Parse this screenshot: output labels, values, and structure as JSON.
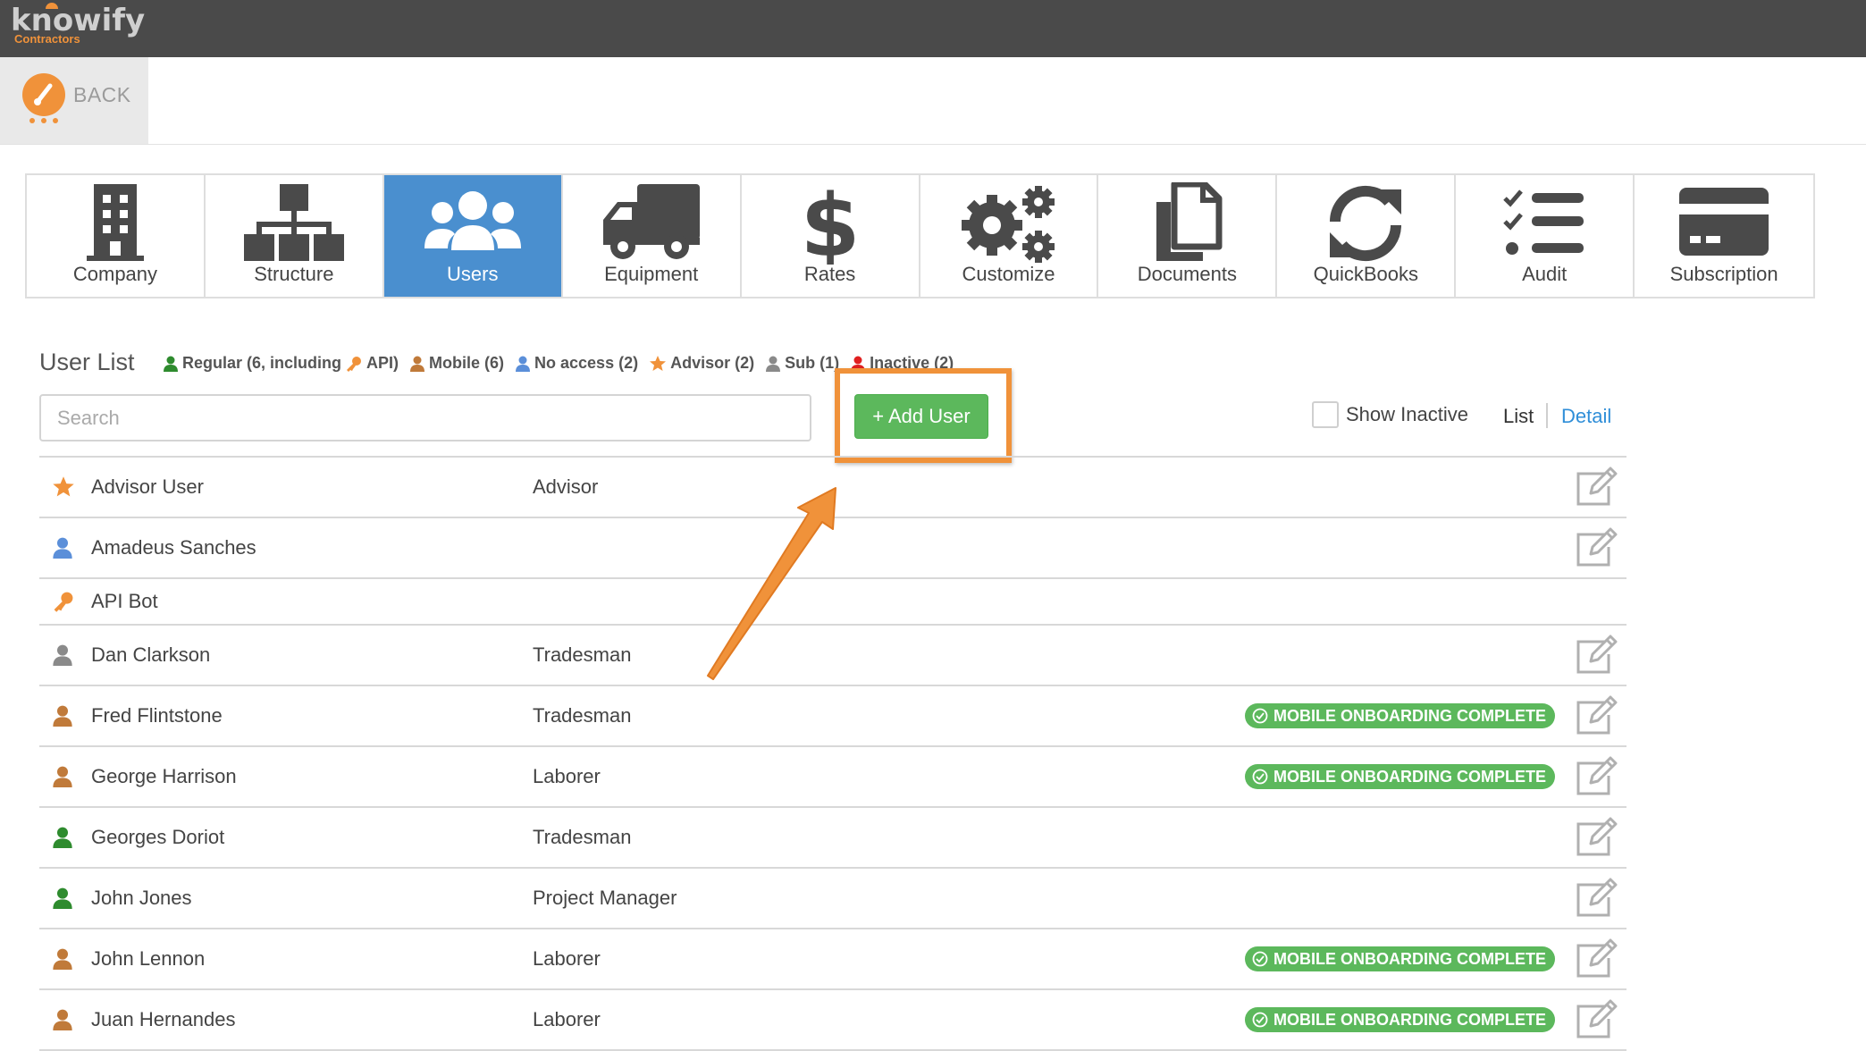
{
  "app": {
    "logo_text": "knowify",
    "logo_sub": "Contractors",
    "back_label": "BACK"
  },
  "tiles": [
    {
      "label": "Company",
      "icon": "building-icon",
      "active": false
    },
    {
      "label": "Structure",
      "icon": "org-chart-icon",
      "active": false
    },
    {
      "label": "Users",
      "icon": "users-icon",
      "active": true
    },
    {
      "label": "Equipment",
      "icon": "truck-icon",
      "active": false
    },
    {
      "label": "Rates",
      "icon": "dollar-icon",
      "active": false
    },
    {
      "label": "Customize",
      "icon": "gears-icon",
      "active": false
    },
    {
      "label": "Documents",
      "icon": "documents-icon",
      "active": false
    },
    {
      "label": "QuickBooks",
      "icon": "sync-icon",
      "active": false
    },
    {
      "label": "Audit",
      "icon": "checklist-icon",
      "active": false
    },
    {
      "label": "Subscription",
      "icon": "credit-card-icon",
      "active": false
    }
  ],
  "user_list": {
    "title": "User List",
    "legend": {
      "regular": "Regular (6, including",
      "api": "API)",
      "mobile": "Mobile (6)",
      "no_access": "No access (2)",
      "advisor": "Advisor (2)",
      "sub": "Sub (1)",
      "inactive": "Inactive (2)"
    },
    "search_placeholder": "Search",
    "add_user_label": "+ Add User",
    "show_inactive_label": "Show Inactive",
    "view_list": "List",
    "view_detail": "Detail",
    "colors": {
      "regular": "#2e8b2e",
      "mobile": "#c07a3a",
      "no_access": "#5b8fd9",
      "advisor": "#f0923a",
      "sub": "#8a8a8a",
      "inactive": "#e02020",
      "accent": "#4a8fcf",
      "success": "#5cb85c",
      "highlight": "#f0923a"
    },
    "badge_text": "MOBILE ONBOARDING COMPLETE",
    "rows": [
      {
        "name": "Advisor User",
        "role": "Advisor",
        "type": "advisor",
        "badge": false,
        "edit": true
      },
      {
        "name": "Amadeus Sanches",
        "role": "",
        "type": "no_access",
        "badge": false,
        "edit": true
      },
      {
        "name": "API Bot",
        "role": "",
        "type": "api",
        "badge": false,
        "edit": false
      },
      {
        "name": "Dan Clarkson",
        "role": "Tradesman",
        "type": "sub",
        "badge": false,
        "edit": true
      },
      {
        "name": "Fred Flintstone",
        "role": "Tradesman",
        "type": "mobile",
        "badge": true,
        "edit": true
      },
      {
        "name": "George Harrison",
        "role": "Laborer",
        "type": "mobile",
        "badge": true,
        "edit": true
      },
      {
        "name": "Georges Doriot",
        "role": "Tradesman",
        "type": "regular",
        "badge": false,
        "edit": true
      },
      {
        "name": "John Jones",
        "role": "Project Manager",
        "type": "regular",
        "badge": false,
        "edit": true
      },
      {
        "name": "John Lennon",
        "role": "Laborer",
        "type": "mobile",
        "badge": true,
        "edit": true
      },
      {
        "name": "Juan Hernandes",
        "role": "Laborer",
        "type": "mobile",
        "badge": true,
        "edit": true
      }
    ]
  }
}
